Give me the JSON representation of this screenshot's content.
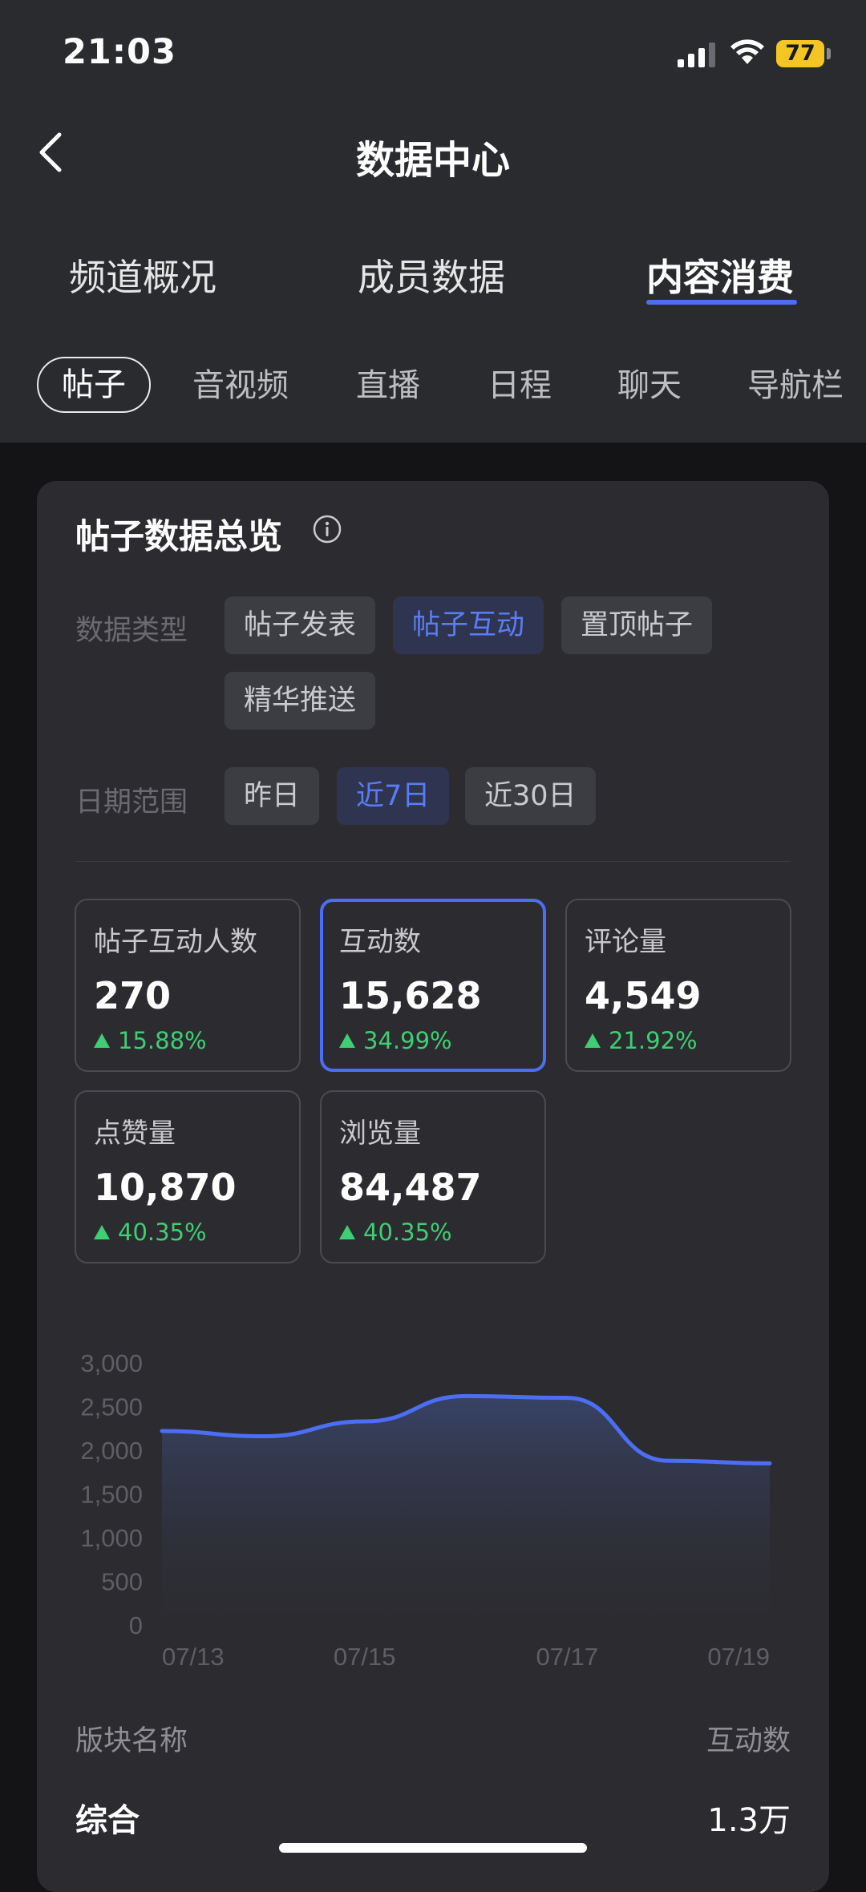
{
  "status_bar": {
    "time": "21:03",
    "battery": "77"
  },
  "header": {
    "title": "数据中心"
  },
  "tabs": [
    {
      "label": "频道概况"
    },
    {
      "label": "成员数据"
    },
    {
      "label": "内容消费"
    }
  ],
  "subtabs": [
    {
      "label": "帖子"
    },
    {
      "label": "音视频"
    },
    {
      "label": "直播"
    },
    {
      "label": "日程"
    },
    {
      "label": "聊天"
    },
    {
      "label": "导航栏"
    }
  ],
  "overview": {
    "title": "帖子数据总览",
    "data_type_label": "数据类型",
    "data_types": [
      "帖子发表",
      "帖子互动",
      "置顶帖子",
      "精华推送"
    ],
    "date_range_label": "日期范围",
    "date_ranges": [
      "昨日",
      "近7日",
      "近30日"
    ]
  },
  "metrics": [
    {
      "label": "帖子互动人数",
      "value": "270",
      "change": "15.88%"
    },
    {
      "label": "互动数",
      "value": "15,628",
      "change": "34.99%"
    },
    {
      "label": "评论量",
      "value": "4,549",
      "change": "21.92%"
    },
    {
      "label": "点赞量",
      "value": "10,870",
      "change": "40.35%"
    },
    {
      "label": "浏览量",
      "value": "84,487",
      "change": "40.35%"
    }
  ],
  "colors": {
    "accent": "#4c6ef5",
    "positive": "#3ecf74",
    "background": "#141417",
    "card": "#2c2c30"
  },
  "chart_data": {
    "type": "area",
    "x": [
      "07/13",
      "07/14",
      "07/15",
      "07/16",
      "07/17",
      "07/18",
      "07/19"
    ],
    "values": [
      2220,
      2160,
      2330,
      2620,
      2600,
      1880,
      1850
    ],
    "xticks": [
      "07/13",
      "07/15",
      "07/17",
      "07/19"
    ],
    "yticks": [
      "3,000",
      "2,500",
      "2,000",
      "1,500",
      "1,000",
      "500",
      "0"
    ],
    "ylim": [
      0,
      3000
    ],
    "grid": false,
    "legend": "none"
  },
  "table": {
    "col_name": "版块名称",
    "col_value": "互动数",
    "rows": [
      {
        "name": "综合",
        "value": "1.3万"
      }
    ]
  }
}
